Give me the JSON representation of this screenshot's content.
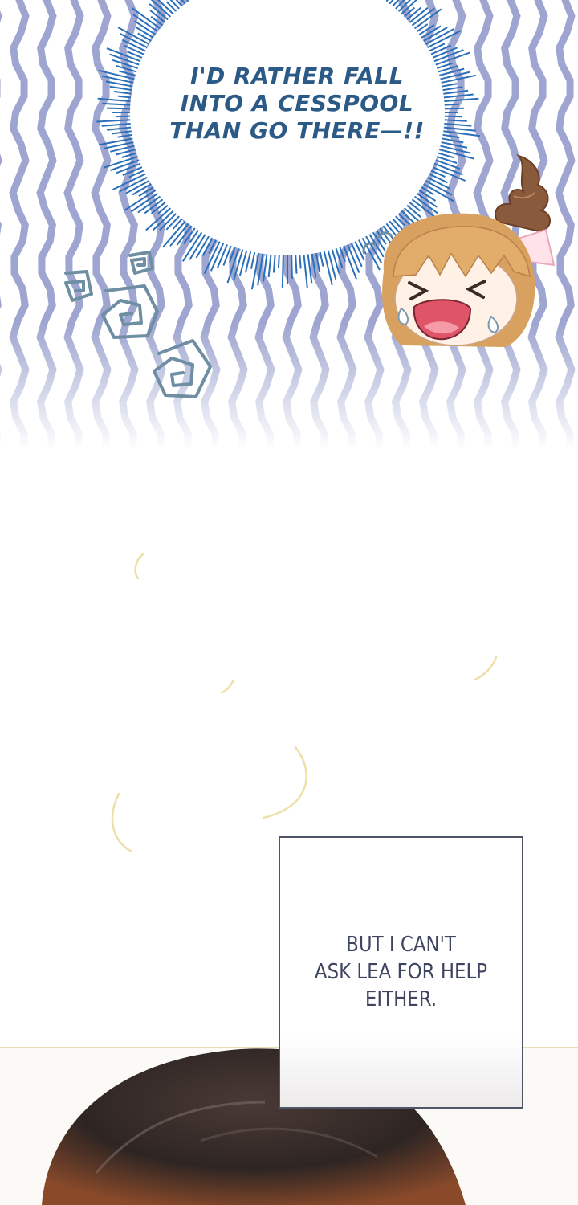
{
  "panel_top": {
    "shout_text": "I'D RATHER FALL\nINTO A CESSPOOL\nTHAN GO THERE—!!"
  },
  "panel_bottom": {
    "caption_text": "BUT I CAN'T\nASK LEA FOR HELP\nEITHER."
  }
}
